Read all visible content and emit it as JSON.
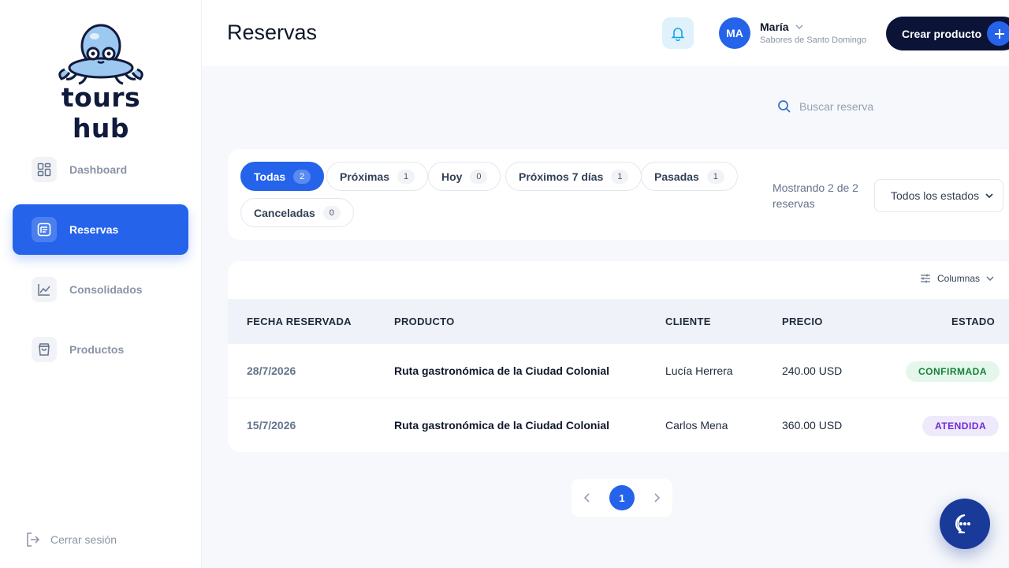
{
  "brand": {
    "name": "tours hub"
  },
  "sidebar": {
    "items": [
      {
        "label": "Dashboard",
        "icon": "grid-icon",
        "active": false
      },
      {
        "label": "Reservas",
        "icon": "list-icon",
        "active": true
      },
      {
        "label": "Consolidados",
        "icon": "chart-icon",
        "active": false
      },
      {
        "label": "Productos",
        "icon": "bag-icon",
        "active": false
      }
    ],
    "logout_label": "Cerrar sesión"
  },
  "header": {
    "title": "Reservas",
    "user": {
      "initials": "MA",
      "name": "María",
      "company": "Sabores de Santo Domingo"
    },
    "create_label": "Crear producto"
  },
  "search": {
    "placeholder": "Buscar reserva"
  },
  "filters": {
    "chips": [
      {
        "label": "Todas",
        "count": "2",
        "active": true
      },
      {
        "label": "Próximas",
        "count": "1"
      },
      {
        "label": "Hoy",
        "count": "0"
      },
      {
        "label": "Próximos 7 días",
        "count": "1"
      },
      {
        "label": "Pasadas",
        "count": "1"
      },
      {
        "label": "Canceladas",
        "count": "0"
      }
    ],
    "showing": "Mostrando 2 de 2 reservas",
    "status_select": "Todos los estados"
  },
  "table": {
    "columns_label": "Columnas",
    "headers": [
      "FECHA RESERVADA",
      "PRODUCTO",
      "CLIENTE",
      "PRECIO",
      "ESTADO"
    ],
    "rows": [
      {
        "date": "28/7/2026",
        "product": "Ruta gastronómica de la Ciudad Colonial",
        "client": "Lucía Herrera",
        "price": "240.00 USD",
        "status": "CONFIRMADA"
      },
      {
        "date": "15/7/2026",
        "product": "Ruta gastronómica de la Ciudad Colonial",
        "client": "Carlos Mena",
        "price": "360.00 USD",
        "status": "ATENDIDA"
      }
    ]
  },
  "pagination": {
    "current": "1"
  },
  "colors": {
    "accent": "#2563eb",
    "dark": "#0b1437",
    "confirmed": "#15803d",
    "attended": "#6d28d9"
  }
}
